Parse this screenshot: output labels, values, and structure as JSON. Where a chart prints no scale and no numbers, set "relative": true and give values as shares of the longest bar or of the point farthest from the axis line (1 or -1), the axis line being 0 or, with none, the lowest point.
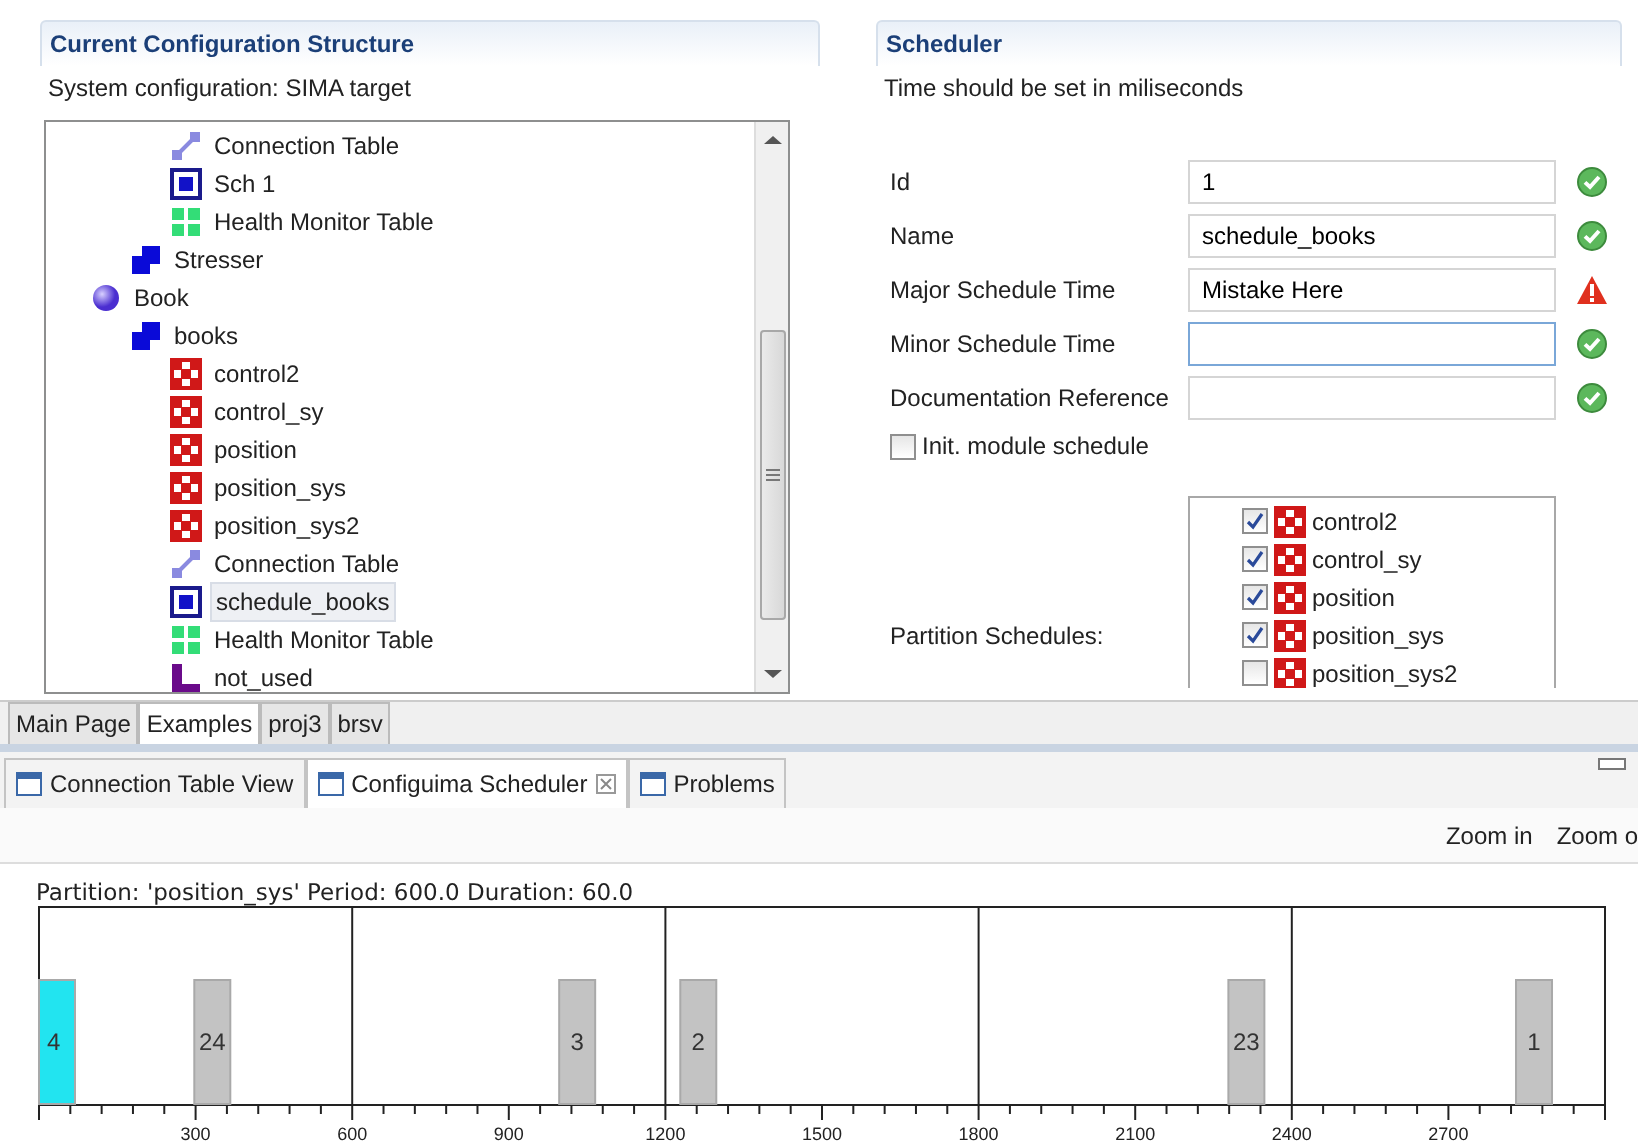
{
  "config_panel": {
    "title": "Current Configuration Structure",
    "subtitle": "System configuration: SIMA target",
    "tree": [
      {
        "children": [
          {
            "children": [
              {
                "label": "Connection Table",
                "kind": "connection",
                "selected": false
              },
              {
                "label": "Sch 1",
                "kind": "schedule",
                "selected": false
              },
              {
                "label": "Health Monitor Table",
                "kind": "health",
                "selected": false
              }
            ]
          },
          {
            "label": "Stresser",
            "kind": "group",
            "selected": false
          }
        ]
      },
      {
        "label": "Book",
        "kind": "module",
        "selected": false,
        "children": [
          {
            "label": "books",
            "kind": "group",
            "selected": false,
            "children": [
              {
                "label": "control2",
                "kind": "partition",
                "selected": false
              },
              {
                "label": "control_sy",
                "kind": "partition",
                "selected": false
              },
              {
                "label": "position",
                "kind": "partition",
                "selected": false
              },
              {
                "label": "position_sys",
                "kind": "partition",
                "selected": false
              },
              {
                "label": "position_sys2",
                "kind": "partition",
                "selected": false
              },
              {
                "label": "Connection Table",
                "kind": "connection",
                "selected": false
              },
              {
                "label": "schedule_books",
                "kind": "schedule",
                "selected": true
              },
              {
                "label": "Health Monitor Table",
                "kind": "health",
                "selected": false
              },
              {
                "label": "not_used",
                "kind": "unused",
                "selected": false
              }
            ]
          }
        ]
      }
    ]
  },
  "scheduler_panel": {
    "title": "Scheduler",
    "subtitle": "Time should be set in miliseconds",
    "fields": [
      {
        "label": "Id",
        "value": "1",
        "error": false,
        "focused": false
      },
      {
        "label": "Name",
        "value": "schedule_books",
        "error": false,
        "focused": false
      },
      {
        "label": "Major Schedule Time",
        "value": "Mistake Here",
        "error": true,
        "focused": false
      },
      {
        "label": "Minor Schedule Time",
        "error": false,
        "focused": true
      },
      {
        "label": "Documentation Reference",
        "error": false,
        "focused": false
      }
    ],
    "init_checkbox": {
      "label": "Init. module schedule",
      "checked": false
    },
    "partition_label": "Partition Schedules:",
    "partitions": [
      {
        "label": "control2",
        "checked": true
      },
      {
        "label": "control_sy",
        "checked": true
      },
      {
        "label": "position",
        "checked": true
      },
      {
        "label": "position_sys",
        "checked": true
      },
      {
        "label": "position_sys2",
        "checked": false
      }
    ]
  },
  "editor_tabs": [
    {
      "label": "Main Page",
      "selected": false
    },
    {
      "label": "Examples",
      "selected": true
    },
    {
      "label": "proj3",
      "selected": false
    },
    {
      "label": "brsv",
      "selected": false
    }
  ],
  "view_tabs": [
    {
      "label": "Connection Table View",
      "selected": false,
      "closable": false
    },
    {
      "label": "Configuima Scheduler",
      "selected": true,
      "closable": true
    },
    {
      "label": "Problems",
      "selected": false,
      "closable": false
    }
  ],
  "toolbar": [
    "Zoom in",
    "Zoom o"
  ],
  "timeline": {
    "caption": "Partition: 'position_sys' Period: 600.0 Duration: 60.0",
    "chart_data": {
      "type": "bar",
      "x": [
        28,
        332,
        1031,
        1263,
        2313,
        2864
      ],
      "xlim": [
        0,
        3000
      ],
      "xticks": [
        300,
        600,
        900,
        1200,
        1500,
        1800,
        2100,
        2400,
        2700
      ],
      "grid": true,
      "relative": true,
      "stacked": true,
      "series": [
        {
          "color": "#22e4f0",
          "values": [
            1,
            null,
            null,
            null,
            null,
            null
          ]
        },
        {
          "color": "#c3c3c3",
          "values": [
            null,
            1,
            1,
            1,
            1,
            1
          ]
        }
      ],
      "value_labels": [
        "4",
        "24",
        "3",
        "2",
        "23",
        "1"
      ]
    }
  }
}
